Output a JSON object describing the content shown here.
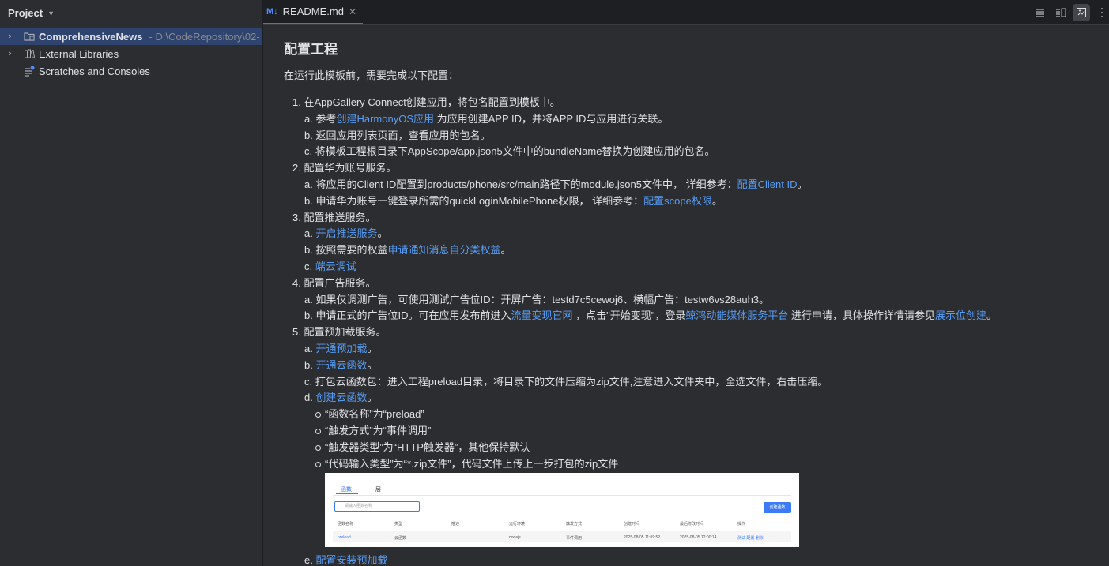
{
  "project_panel": {
    "title": "Project",
    "tree": [
      {
        "label": "ComprehensiveNews",
        "path": "- D:\\CodeRepository\\02-",
        "icon": "module-folder-icon"
      },
      {
        "label": "External Libraries",
        "icon": "library-icon"
      },
      {
        "label": "Scratches and Consoles",
        "icon": "scratches-icon"
      }
    ]
  },
  "editor": {
    "tab": {
      "icon": "M↓",
      "label": "README.md"
    }
  },
  "doc": {
    "heading": "配置工程",
    "intro": "在运行此模板前，需要完成以下配置：",
    "steps": {
      "s1": {
        "num": "1.",
        "text": "在AppGallery Connect创建应用，将包名配置到模板中。",
        "a_pre": "参考",
        "a_link": "创建HarmonyOS应用",
        "a_post": " 为应用创建APP ID，并将APP ID与应用进行关联。",
        "b": "返回应用列表页面，查看应用的包名。",
        "c": "将模板工程根目录下AppScope/app.json5文件中的bundleName替换为创建应用的包名。"
      },
      "s2": {
        "num": "2.",
        "text": "配置华为账号服务。",
        "a_pre": "将应用的Client ID配置到products/phone/src/main路径下的module.json5文件中， 详细参考：",
        "a_link": "配置Client ID",
        "a_post": "。",
        "b_pre": "申请华为账号一键登录所需的quickLoginMobilePhone权限， 详细参考：",
        "b_link": "配置scope权限",
        "b_post": "。"
      },
      "s3": {
        "num": "3.",
        "text": "配置推送服务。",
        "a_link": "开启推送服务",
        "a_post": "。",
        "b_pre": "按照需要的权益",
        "b_link": "申请通知消息自分类权益",
        "b_post": "。",
        "c_link": "端云调试"
      },
      "s4": {
        "num": "4.",
        "text": "配置广告服务。",
        "a": "如果仅调测广告，可使用测试广告位ID：开屏广告：testd7c5cewoj6、横幅广告：testw6vs28auh3。",
        "b_pre": "申请正式的广告位ID。可在应用发布前进入",
        "b_link1": "流量变现官网",
        "b_mid": " ，点击\"开始变现\"，登录",
        "b_link2": "鲸鸿动能媒体服务平台",
        "b_mid2": " 进行申请，具体操作详情请参见",
        "b_link3": "展示位创建",
        "b_post": "。"
      },
      "s5": {
        "num": "5.",
        "text": "配置预加载服务。",
        "a_link": "开通预加载",
        "a_post": "。",
        "b_link": "开通云函数",
        "b_post": "。",
        "c": "打包云函数包：进入工程preload目录，将目录下的文件压缩为zip文件,注意进入文件夹中，全选文件，右击压缩。",
        "d_link": "创建云函数",
        "d_post": "。",
        "bullets": [
          "“函数名称”为“preload”",
          "“触发方式”为“事件调用”",
          "“触发器类型”为“HTTP触发器”，其他保持默认",
          "“代码输入类型”为“*.zip文件”，代码文件上传上一步打包的zip文件"
        ],
        "e_link": "配置安装预加载"
      }
    },
    "letters": {
      "a": "a.",
      "b": "b.",
      "c": "c.",
      "d": "d.",
      "e": "e."
    }
  },
  "embedded_image": {
    "tabs": [
      "函数",
      "层"
    ],
    "search_placeholder": "请输入函数名称",
    "create_button": "创建函数",
    "columns": [
      "函数名称",
      "类型",
      "描述",
      "运行环境",
      "触发方式",
      "创建时间",
      "最后修改时间",
      "操作"
    ],
    "row": [
      "preload",
      "云函数",
      "",
      "nodejs",
      "事件调用",
      "2025-08-05 11:09:52",
      "2025-08-05 12:00:14",
      "测试 配置 删除 ···"
    ]
  }
}
